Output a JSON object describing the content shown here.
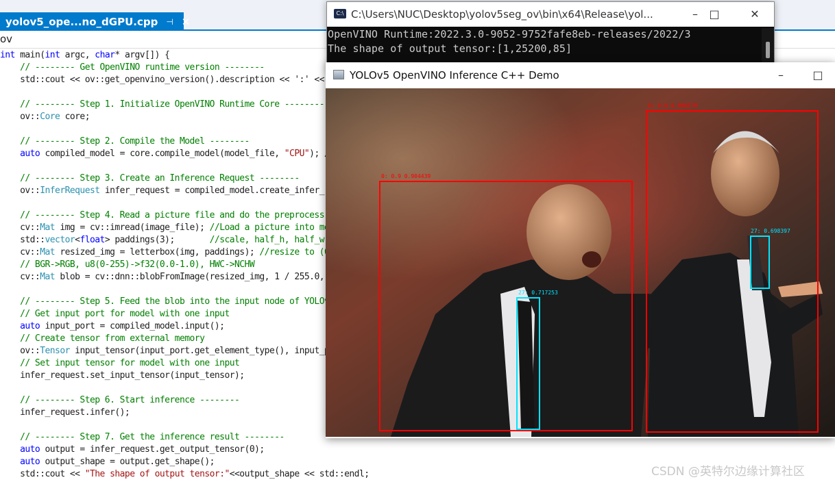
{
  "editor": {
    "tab_title": "yolov5_ope...no_dGPU.cpp",
    "tab_pin_icon": "pin-icon",
    "tab_close_icon": "close-icon",
    "nav_text": "ov",
    "code_lines": [
      [
        [
          "kw",
          "int"
        ],
        [
          "pl",
          " main("
        ],
        [
          "kw",
          "int"
        ],
        [
          "pl",
          " argc, "
        ],
        [
          "kw",
          "char"
        ],
        [
          "pl",
          "* argv[]) {"
        ]
      ],
      [
        [
          "cm",
          "    // -------- Get OpenVINO runtime version --------"
        ]
      ],
      [
        [
          "pl",
          "    std::cout << ov::get_openvino_version().description << ':' <<"
        ]
      ],
      [
        [
          "pl",
          ""
        ]
      ],
      [
        [
          "cm",
          "    // -------- Step 1. Initialize OpenVINO Runtime Core --------"
        ]
      ],
      [
        [
          "pl",
          "    ov::"
        ],
        [
          "ty",
          "Core"
        ],
        [
          "pl",
          " core;"
        ]
      ],
      [
        [
          "pl",
          ""
        ]
      ],
      [
        [
          "cm",
          "    // -------- Step 2. Compile the Model --------"
        ]
      ],
      [
        [
          "kw",
          "    auto"
        ],
        [
          "pl",
          " compiled_model = core.compile_model(model_file, "
        ],
        [
          "st",
          "\"CPU\""
        ],
        [
          "pl",
          "); /"
        ]
      ],
      [
        [
          "pl",
          ""
        ]
      ],
      [
        [
          "cm",
          "    // -------- Step 3. Create an Inference Request --------"
        ]
      ],
      [
        [
          "pl",
          "    ov::"
        ],
        [
          "ty",
          "InferRequest"
        ],
        [
          "pl",
          " infer_request = compiled_model.create_infer_r"
        ]
      ],
      [
        [
          "pl",
          ""
        ]
      ],
      [
        [
          "cm",
          "    // -------- Step 4. Read a picture file and do the preprocess"
        ]
      ],
      [
        [
          "pl",
          "    cv::"
        ],
        [
          "ty",
          "Mat"
        ],
        [
          "pl",
          " img = cv::imread(image_file); "
        ],
        [
          "cm",
          "//Load a picture into me"
        ]
      ],
      [
        [
          "pl",
          "    std::"
        ],
        [
          "ty",
          "vector"
        ],
        [
          "pl",
          "<"
        ],
        [
          "kw",
          "float"
        ],
        [
          "pl",
          "> paddings(3);       "
        ],
        [
          "cm",
          "//scale, half_h, half_w"
        ]
      ],
      [
        [
          "pl",
          "    cv::"
        ],
        [
          "ty",
          "Mat"
        ],
        [
          "pl",
          " resized_img = letterbox(img, paddings); "
        ],
        [
          "cm",
          "//resize to (6"
        ]
      ],
      [
        [
          "cm",
          "    // BGR->RGB, u8(0-255)->f32(0.0-1.0), HWC->NCHW"
        ]
      ],
      [
        [
          "pl",
          "    cv::"
        ],
        [
          "ty",
          "Mat"
        ],
        [
          "pl",
          " blob = cv::dnn::blobFromImage(resized_img, 1 / 255.0,"
        ]
      ],
      [
        [
          "pl",
          ""
        ]
      ],
      [
        [
          "cm",
          "    // -------- Step 5. Feed the blob into the input node of YOLOv"
        ]
      ],
      [
        [
          "cm",
          "    // Get input port for model with one input"
        ]
      ],
      [
        [
          "kw",
          "    auto"
        ],
        [
          "pl",
          " input_port = compiled_model.input();"
        ]
      ],
      [
        [
          "cm",
          "    // Create tensor from external memory"
        ]
      ],
      [
        [
          "pl",
          "    ov::"
        ],
        [
          "ty",
          "Tensor"
        ],
        [
          "pl",
          " input_tensor(input_port.get_element_type(), input_p"
        ]
      ],
      [
        [
          "cm",
          "    // Set input tensor for model with one input"
        ]
      ],
      [
        [
          "pl",
          "    infer_request.set_input_tensor(input_tensor);"
        ]
      ],
      [
        [
          "pl",
          ""
        ]
      ],
      [
        [
          "cm",
          "    // -------- Step 6. Start inference --------"
        ]
      ],
      [
        [
          "pl",
          "    infer_request.infer();"
        ]
      ],
      [
        [
          "pl",
          ""
        ]
      ],
      [
        [
          "cm",
          "    // -------- Step 7. Get the inference result --------"
        ]
      ],
      [
        [
          "kw",
          "    auto"
        ],
        [
          "pl",
          " output = infer_request.get_output_tensor(0);"
        ]
      ],
      [
        [
          "kw",
          "    auto"
        ],
        [
          "pl",
          " output_shape = output.get_shape();"
        ]
      ],
      [
        [
          "pl",
          "    std::cout << "
        ],
        [
          "st",
          "\"The shape of output tensor:\""
        ],
        [
          "pl",
          "<<output_shape << std::endl;"
        ]
      ]
    ],
    "colors": {
      "keyword": "#0000ff",
      "type": "#2b91af",
      "comment": "#008000",
      "string": "#a31515",
      "tab_active": "#007acc"
    }
  },
  "console": {
    "title": "C:\\Users\\NUC\\Desktop\\yolov5seg_ov\\bin\\x64\\Release\\yol...",
    "icon": "console-icon",
    "icon_text": "C:\\",
    "minimize_icon": "minimize-icon",
    "maximize_icon": "maximize-icon",
    "close_icon": "close-icon",
    "lines": [
      "OpenVINO Runtime:2022.3.0-9052-9752fafe8eb-releases/2022/3",
      "The shape of output tensor:[1,25200,85]"
    ]
  },
  "demo": {
    "title": "YOLOv5 OpenVINO Inference C++ Demo",
    "icon": "window-icon",
    "minimize_icon": "minimize-icon",
    "maximize_icon": "maximize-icon",
    "detections": [
      {
        "class": "person",
        "label": "0: 0.9 0.904439",
        "color": "#ff0000"
      },
      {
        "class": "person",
        "label": "0: 0.9 0.906579",
        "color": "#ff0000"
      },
      {
        "class": "tie",
        "label": "27: 0.717253",
        "color": "#00e5ff"
      },
      {
        "class": "tie",
        "label": "27: 0.698397",
        "color": "#00e5ff"
      }
    ]
  },
  "watermark": "CSDN @英特尔边缘计算社区"
}
